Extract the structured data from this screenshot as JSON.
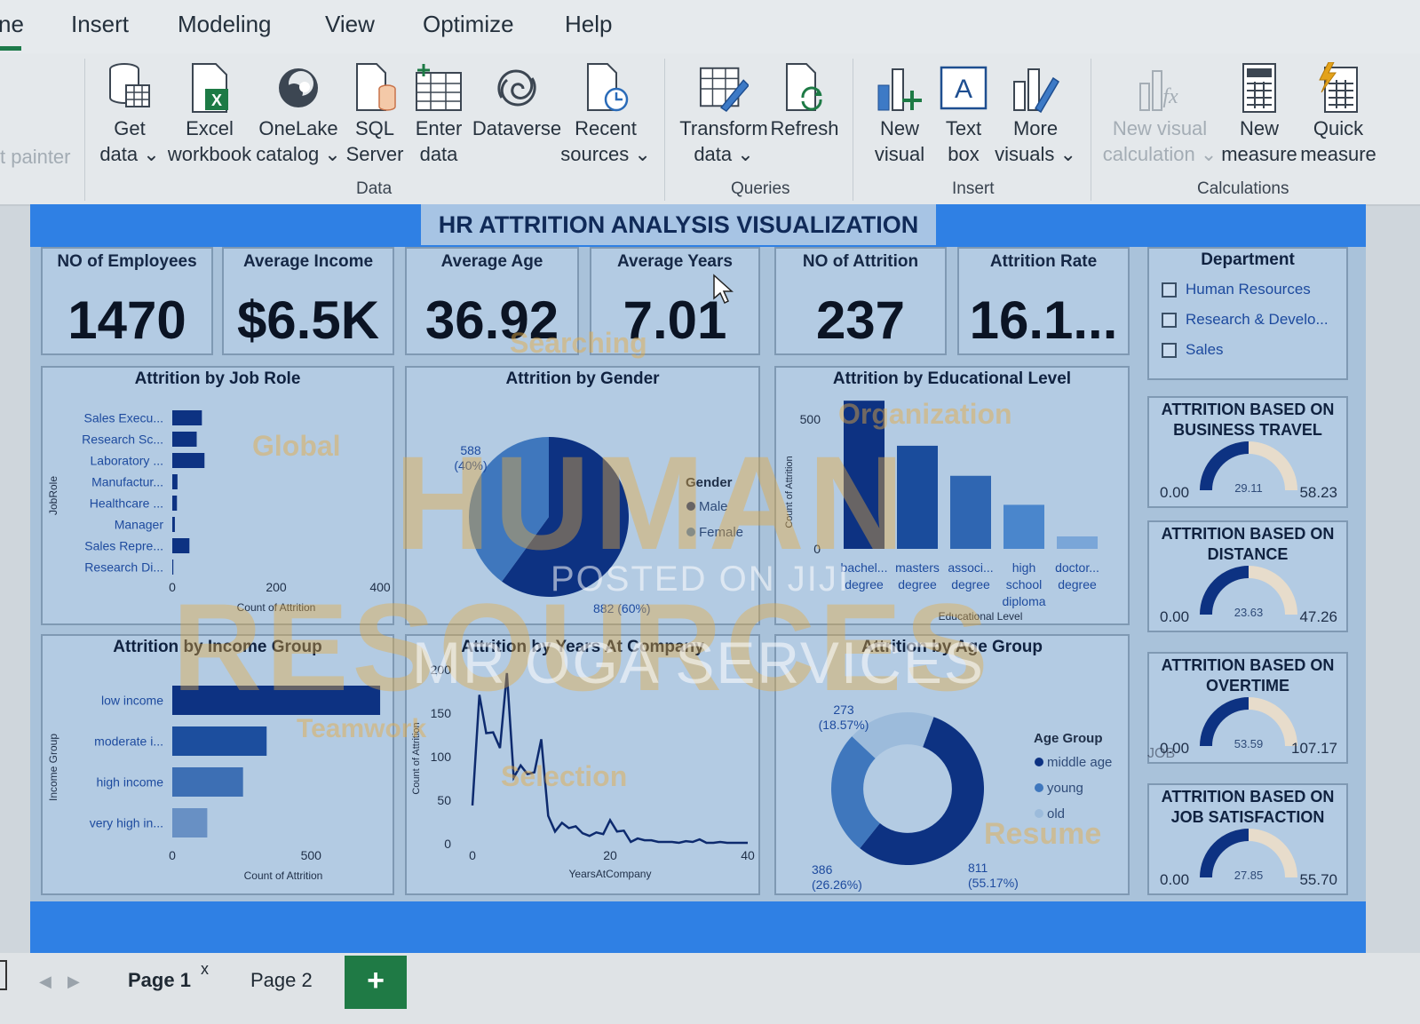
{
  "menu": [
    "ne",
    "Insert",
    "Modeling",
    "View",
    "Optimize",
    "Help"
  ],
  "ribbon": {
    "format_painter": "t painter",
    "buttons": [
      {
        "l1": "Get",
        "l2": "data ⌄"
      },
      {
        "l1": "Excel",
        "l2": "workbook"
      },
      {
        "l1": "OneLake",
        "l2": "catalog ⌄"
      },
      {
        "l1": "SQL",
        "l2": "Server"
      },
      {
        "l1": "Enter",
        "l2": "data"
      },
      {
        "l1": "Dataverse",
        "l2": ""
      },
      {
        "l1": "Recent",
        "l2": "sources ⌄"
      },
      {
        "l1": "Transform",
        "l2": "data ⌄"
      },
      {
        "l1": "Refresh",
        "l2": ""
      },
      {
        "l1": "New",
        "l2": "visual"
      },
      {
        "l1": "Text",
        "l2": "box"
      },
      {
        "l1": "More",
        "l2": "visuals ⌄"
      },
      {
        "l1": "New visual",
        "l2": "calculation ⌄"
      },
      {
        "l1": "New",
        "l2": "measure"
      },
      {
        "l1": "Quick",
        "l2": "measure"
      }
    ],
    "groups": [
      "Data",
      "Queries",
      "Insert",
      "Calculations"
    ]
  },
  "report": {
    "title": "HR ATTRITION ANALYSIS VISUALIZATION",
    "kpis": [
      {
        "label": "NO of Employees",
        "value": "1470"
      },
      {
        "label": "Average Income",
        "value": "$6.5K"
      },
      {
        "label": "Average Age",
        "value": "36.92"
      },
      {
        "label": "Average Years",
        "value": "7.01"
      },
      {
        "label": "NO of Attrition",
        "value": "237"
      },
      {
        "label": "Attrition Rate",
        "value": "16.1..."
      }
    ],
    "slicer": {
      "title": "Department",
      "items": [
        "Human Resources",
        "Research & Develo...",
        "Sales"
      ]
    },
    "gauges": [
      {
        "title": "ATTRITION BASED ON BUSINESS TRAVEL",
        "min": "0.00",
        "value": "29.11",
        "max": "58.23"
      },
      {
        "title": "ATTRITION BASED ON DISTANCE",
        "min": "0.00",
        "value": "23.63",
        "max": "47.26"
      },
      {
        "title": "ATTRITION BASED ON OVERTIME",
        "min": "0.00",
        "value": "53.59",
        "max": "107.17"
      },
      {
        "title": "ATTRITION BASED ON JOB SATISFACTION",
        "min": "0.00",
        "value": "27.85",
        "max": "55.70"
      }
    ],
    "watermarks": {
      "posted": "POSTED ON JIJI",
      "services": "MR OGA SERVICES",
      "human": "HUMAN",
      "resources": "RESOURCES",
      "global": "Global",
      "searching": "Searching",
      "organization": "Organization",
      "teamwork": "Teamwork",
      "selection": "Selection",
      "resume": "Resume",
      "job": "JOB"
    }
  },
  "chart_data": [
    {
      "type": "bar",
      "orientation": "horizontal",
      "title": "Attrition by Job Role",
      "xlabel": "Count of Attrition",
      "ylabel": "JobRole",
      "categories": [
        "Sales Execu...",
        "Research Sc...",
        "Laboratory ...",
        "Manufactur...",
        "Healthcare ...",
        "Manager",
        "Sales Repre...",
        "Research Di..."
      ],
      "values": [
        57,
        47,
        62,
        10,
        9,
        5,
        33,
        2
      ],
      "xticks": [
        "0",
        "200",
        "400"
      ],
      "xlim": [
        0,
        400
      ],
      "color": "#0d3282"
    },
    {
      "type": "pie",
      "title": "Attrition by Gender",
      "legend_title": "Gender",
      "labels": [
        "Male",
        "Female"
      ],
      "values": [
        882,
        588
      ],
      "value_labels": [
        "882 (60%)",
        "588\n(40%)"
      ],
      "colors": [
        "#0d3282",
        "#3f77bd"
      ]
    },
    {
      "type": "bar",
      "title": "Attrition by Educational Level",
      "xlabel": "Educational Level",
      "ylabel": "Count of Attrition",
      "categories": [
        "bachel... degree",
        "masters degree",
        "associ... degree",
        "high school diploma",
        "doctor... degree"
      ],
      "values": [
        572,
        398,
        282,
        170,
        48
      ],
      "yticks": [
        "0",
        "500"
      ],
      "ylim": [
        0,
        600
      ],
      "colors": [
        "#0d3282",
        "#1a4c9c",
        "#2f66b2",
        "#4a86cc",
        "#7aa6d8"
      ]
    },
    {
      "type": "bar",
      "orientation": "horizontal",
      "title": "Attrition by Income Group",
      "xlabel": "Count of Attrition",
      "ylabel": "Income Group",
      "categories": [
        "low income",
        "moderate i...",
        "high income",
        "very high in..."
      ],
      "values": [
        749,
        340,
        255,
        126
      ],
      "xticks": [
        "0",
        "500"
      ],
      "xlim": [
        0,
        800
      ],
      "colors": [
        "#0d3282",
        "#1c4e9e",
        "#3d6fb4",
        "#6890c4"
      ]
    },
    {
      "type": "line",
      "title": "Attrition by Years At Company",
      "xlabel": "YearsAtCompany",
      "ylabel": "Count of Attrition",
      "x": [
        0,
        1,
        2,
        3,
        4,
        5,
        6,
        7,
        8,
        9,
        10,
        11,
        12,
        13,
        14,
        15,
        16,
        17,
        18,
        19,
        20,
        21,
        22,
        23,
        24,
        25,
        26,
        27,
        28,
        29,
        30,
        31,
        32,
        33,
        34,
        35,
        36,
        37,
        38,
        39,
        40
      ],
      "y": [
        44,
        171,
        127,
        128,
        110,
        196,
        76,
        90,
        80,
        82,
        120,
        32,
        14,
        24,
        18,
        20,
        12,
        9,
        13,
        11,
        27,
        14,
        15,
        2,
        6,
        4,
        4,
        2,
        2,
        2,
        1,
        3,
        2,
        5,
        1,
        1,
        2,
        1,
        1,
        1,
        1
      ],
      "xticks": [
        "0",
        "20",
        "40"
      ],
      "yticks": [
        "0",
        "50",
        "100",
        "150",
        "200"
      ],
      "xlim": [
        0,
        40
      ],
      "ylim": [
        0,
        200
      ],
      "color": "#0d2a6e"
    },
    {
      "type": "pie",
      "subtype": "donut",
      "title": "Attrition by Age Group",
      "legend_title": "Age Group",
      "labels": [
        "middle age",
        "young",
        "old"
      ],
      "values": [
        811,
        386,
        273
      ],
      "value_labels": [
        "811\n(55.17%)",
        "386\n(26.26%)",
        "273\n(18.57%)"
      ],
      "colors": [
        "#0d3282",
        "#3f77bd",
        "#9cbbdb"
      ]
    }
  ],
  "page_tabs": {
    "page1": "Page 1",
    "page2": "Page 2",
    "close": "x",
    "add": "+"
  }
}
